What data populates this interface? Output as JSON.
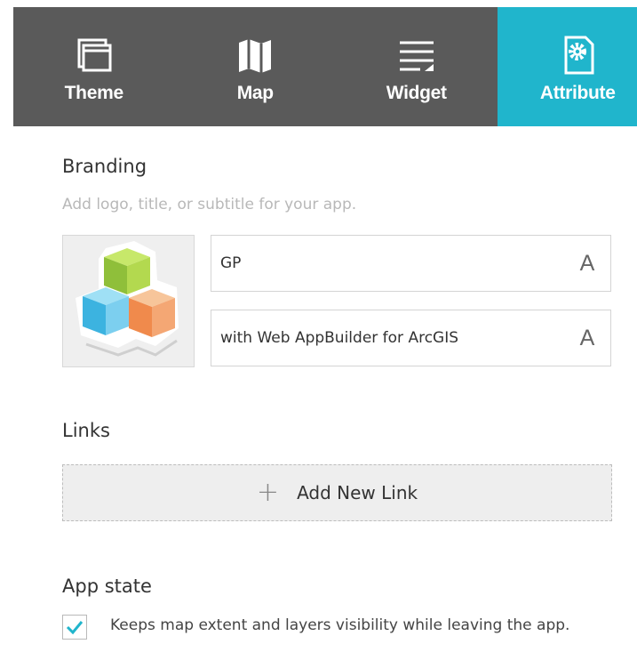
{
  "tabs": [
    {
      "label": "Theme",
      "icon": "theme-icon",
      "active": false
    },
    {
      "label": "Map",
      "icon": "map-icon",
      "active": false
    },
    {
      "label": "Widget",
      "icon": "widget-icon",
      "active": false
    },
    {
      "label": "Attribute",
      "icon": "attribute-gear-icon",
      "active": true
    }
  ],
  "branding": {
    "title": "Branding",
    "hint": "Add logo, title, or subtitle for your app.",
    "logo_icon": "app-logo-cubes-icon",
    "app_title": "GP",
    "app_subtitle": "with Web AppBuilder for ArcGIS",
    "font_button_label": "A"
  },
  "links": {
    "title": "Links",
    "add_label": "Add New Link",
    "add_icon_glyph": "+"
  },
  "app_state": {
    "title": "App state",
    "checkbox_checked": true,
    "checkbox_label": "Keeps map extent and layers visibility while leaving the app."
  },
  "colors": {
    "tabbar_bg": "#5a5a5a",
    "active_tab_bg": "#20b5cc",
    "checkmark": "#20b5cc"
  }
}
